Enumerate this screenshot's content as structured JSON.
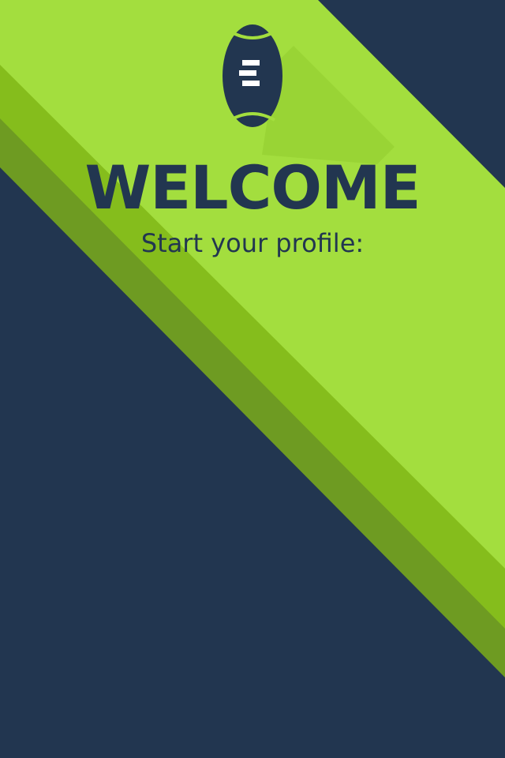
{
  "screen": {
    "title": "WELCOME",
    "subtitle": "Start your profile:"
  },
  "logo": {
    "icon": "football-icon"
  },
  "colors": {
    "navy": "#223650",
    "lime_light": "#a5e040",
    "lime_mid": "#88c21a",
    "lime_dark": "#6e9b22"
  }
}
